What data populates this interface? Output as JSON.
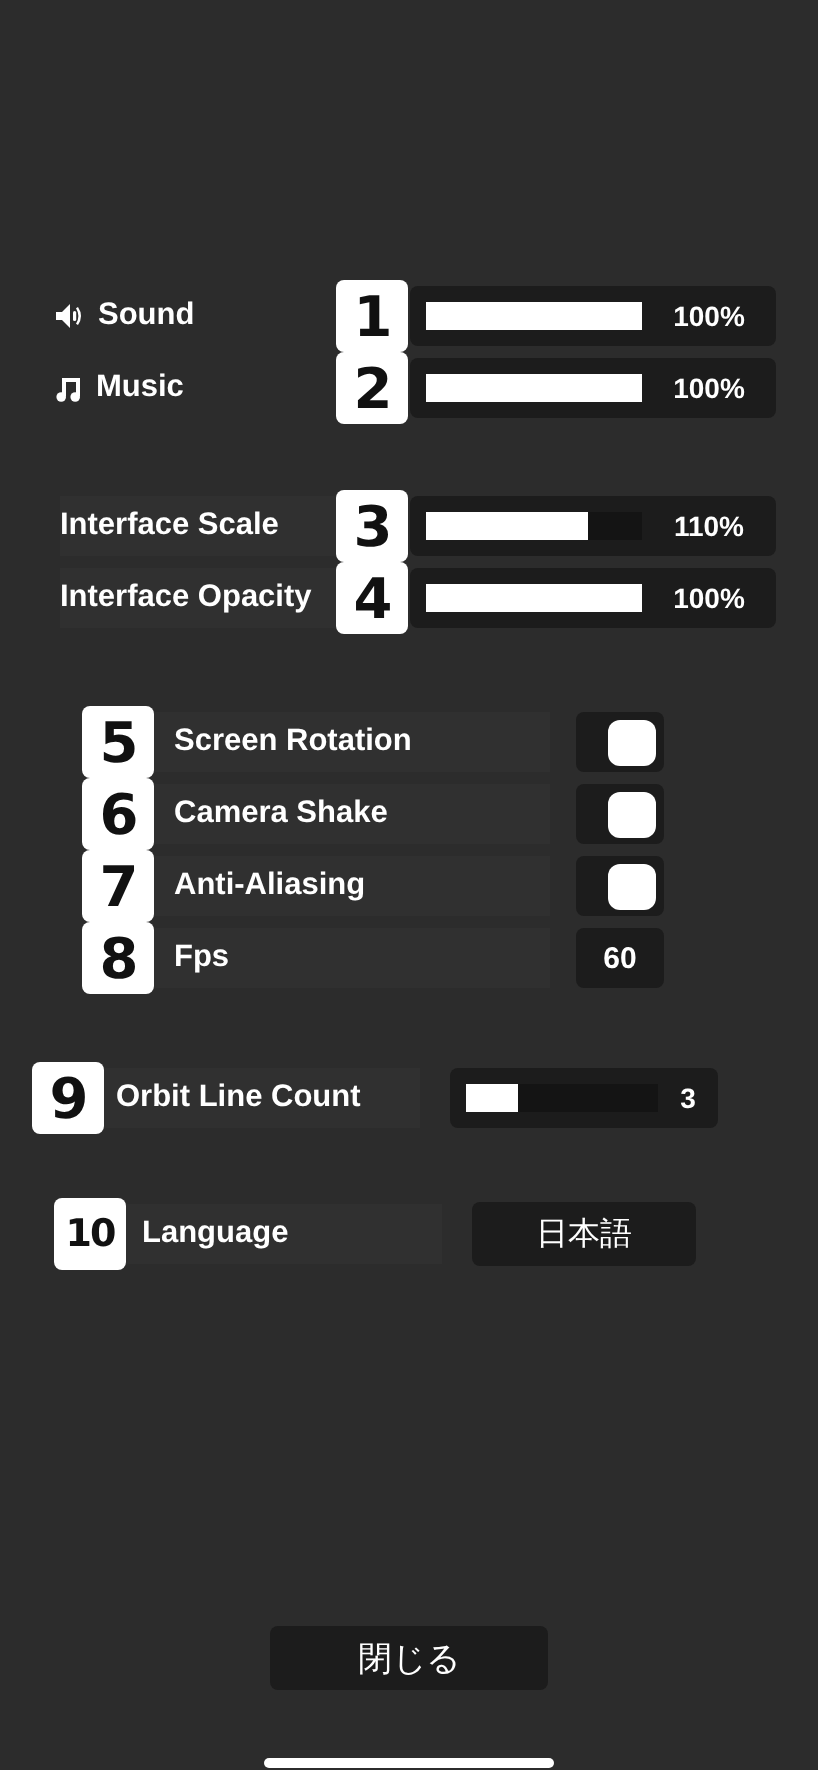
{
  "audio": [
    {
      "number": "1",
      "label": "Sound",
      "level": 1,
      "value": "100%"
    },
    {
      "number": "2",
      "label": "Music",
      "level": 1,
      "value": "100%"
    }
  ],
  "display": [
    {
      "number": "3",
      "label": "Interface Scale",
      "level": 0.75,
      "value": "110%"
    },
    {
      "number": "4",
      "label": "Interface Opacity",
      "level": 1,
      "value": "100%"
    }
  ],
  "options": [
    {
      "kind": "toggle",
      "number": "5",
      "label": "Screen Rotation",
      "on": true
    },
    {
      "kind": "toggle",
      "number": "6",
      "label": "Camera Shake",
      "on": true
    },
    {
      "kind": "toggle",
      "number": "7",
      "label": "Anti-Aliasing",
      "on": true
    },
    {
      "kind": "value",
      "number": "8",
      "label": "Fps",
      "value": "60"
    }
  ],
  "orbit_line_count": {
    "number": "9",
    "label": "Orbit Line Count",
    "level": 0.27,
    "value": "3"
  },
  "language": {
    "number": "10",
    "label": "Language",
    "value": "日本語"
  },
  "close_button": "閉じる"
}
